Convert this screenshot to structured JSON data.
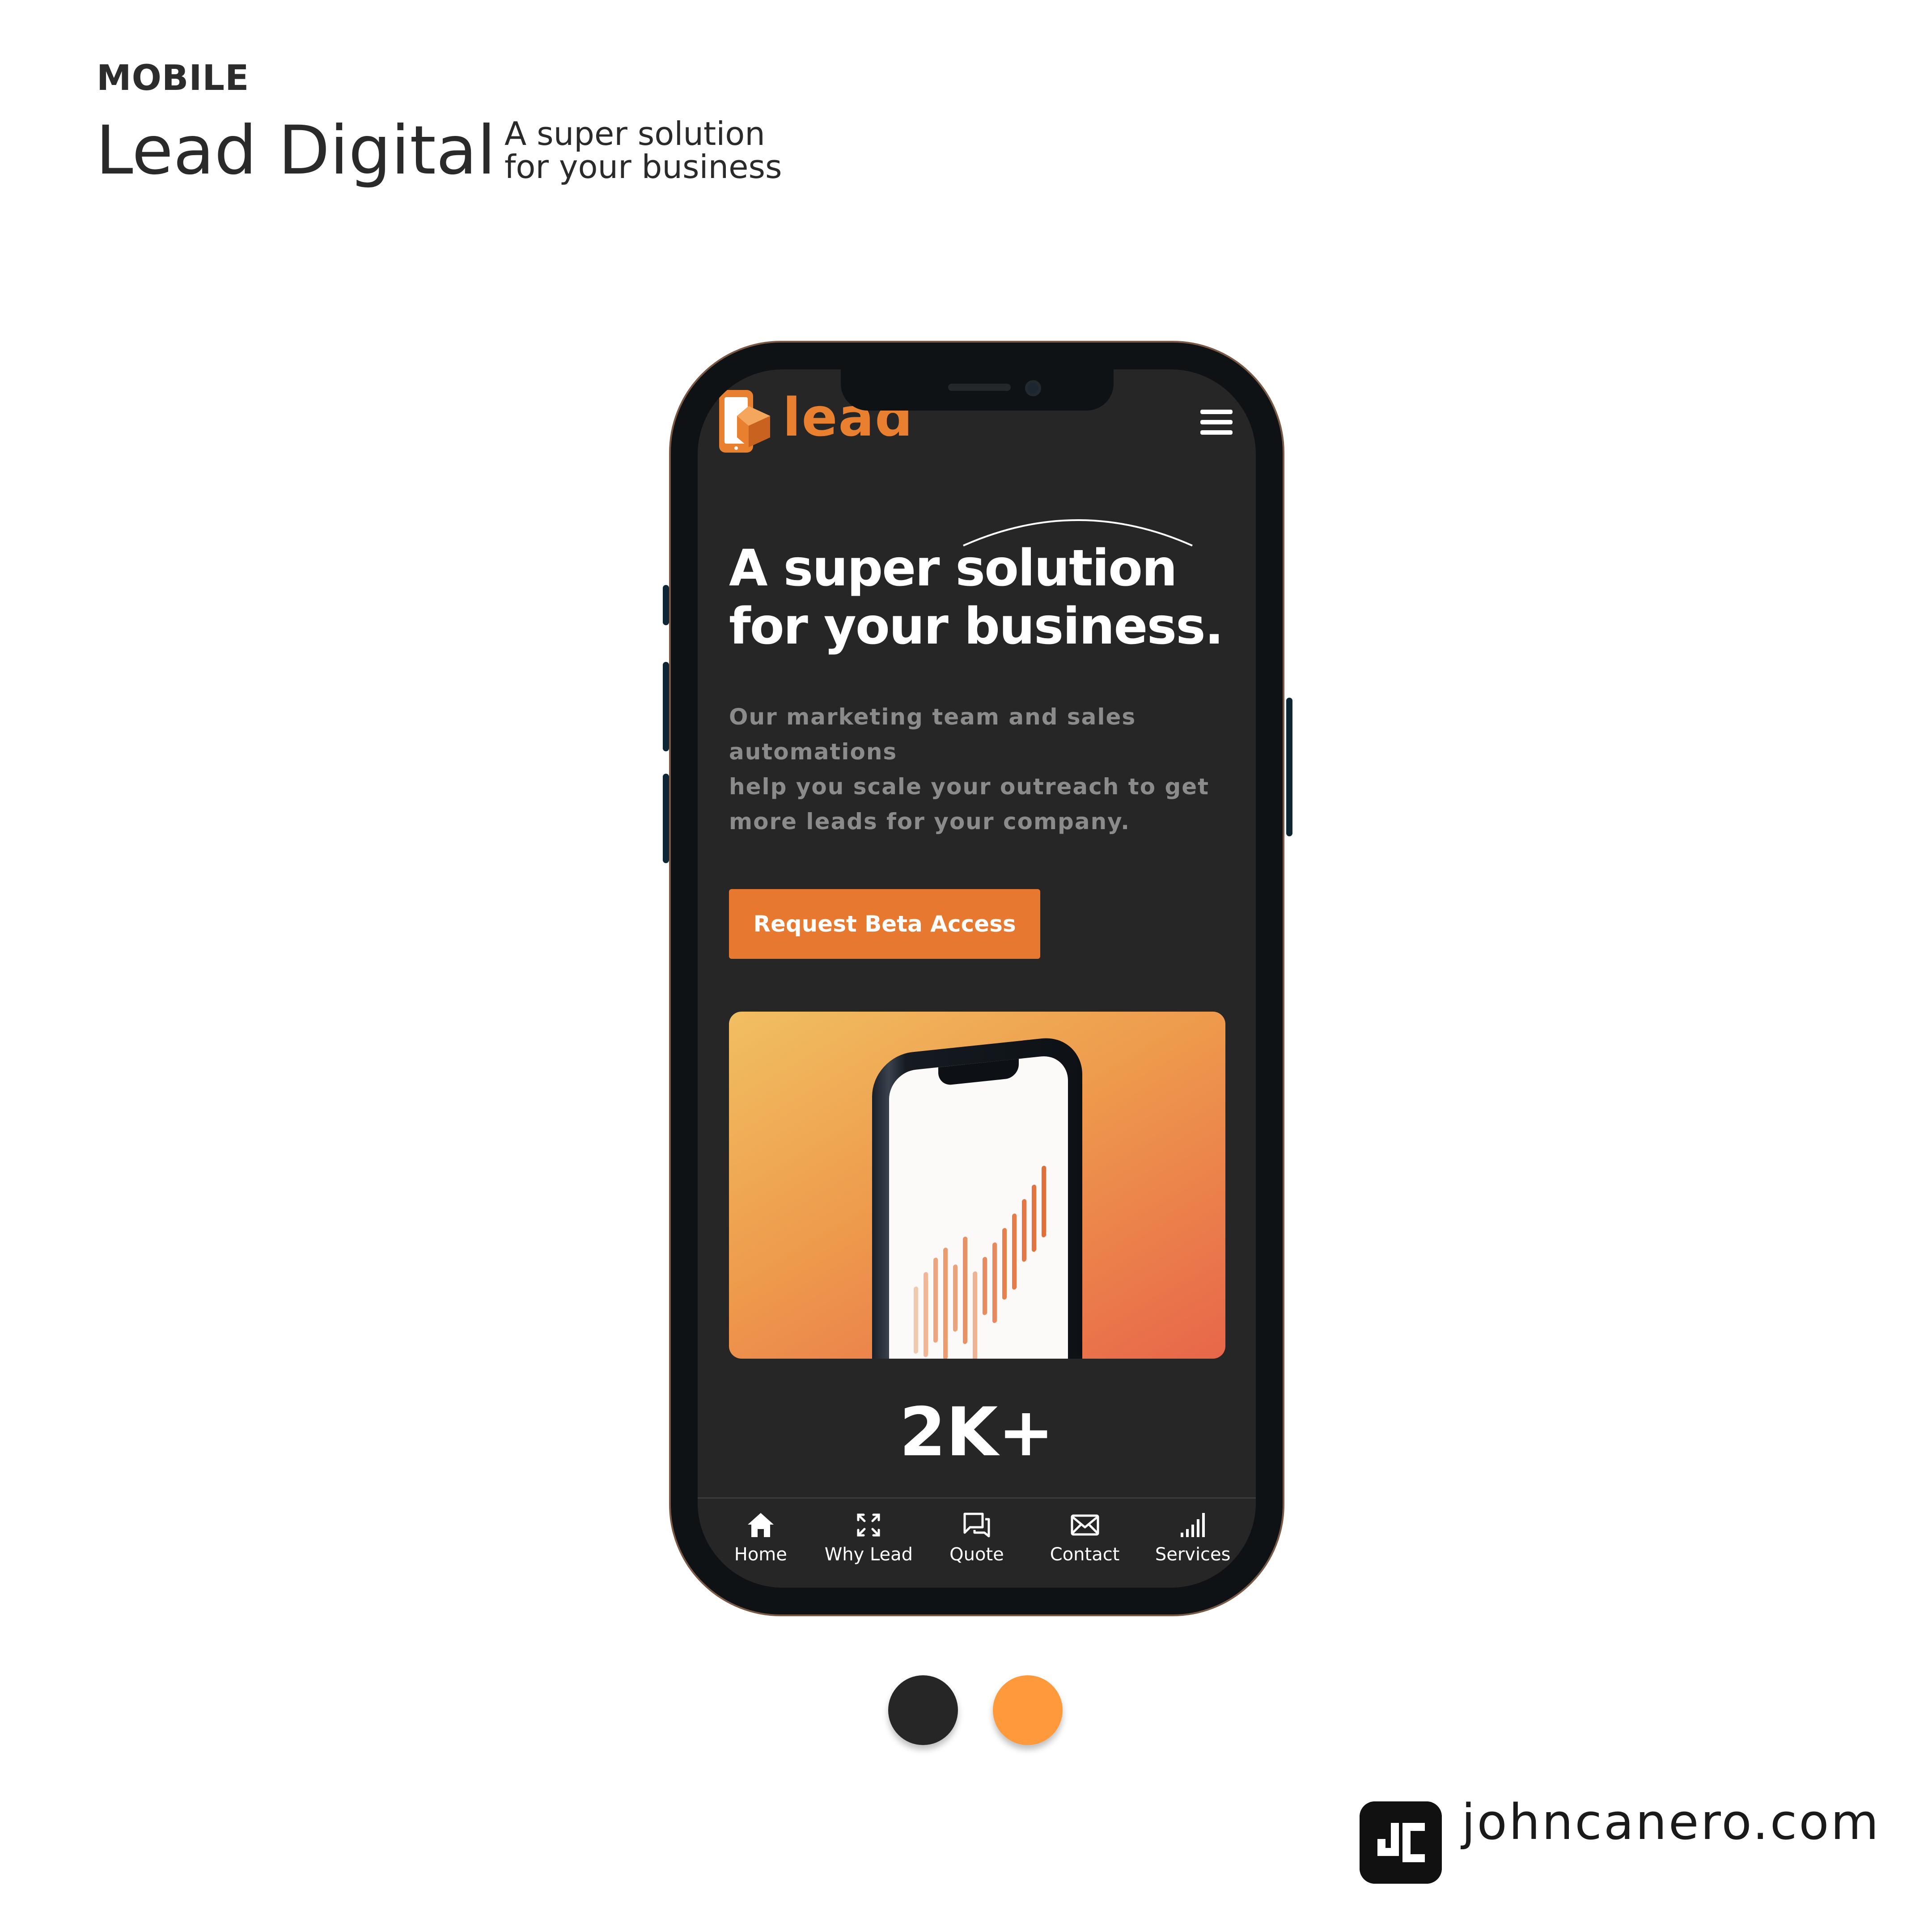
{
  "presentation": {
    "eyebrow": "MOBILE",
    "title": "Lead Digital",
    "subtitle_line1": "A super solution",
    "subtitle_line2": "for your business"
  },
  "app": {
    "logo_text": "lead",
    "menu_icon": "hamburger-icon",
    "hero": {
      "title_line1": "A super solution",
      "title_line2": "for your business.",
      "desc_line1": "Our marketing team and sales",
      "desc_line2": "automations",
      "desc_line3": "help you scale your outreach to get",
      "desc_line4": "more leads for your company.",
      "cta_label": "Request Beta Access"
    },
    "stat_value": "2K+",
    "nav": [
      {
        "label": "Home",
        "icon": "home-icon"
      },
      {
        "label": "Why Lead",
        "icon": "expand-icon"
      },
      {
        "label": "Quote",
        "icon": "chat-icon"
      },
      {
        "label": "Contact",
        "icon": "mail-icon"
      },
      {
        "label": "Services",
        "icon": "signal-bars-icon"
      }
    ]
  },
  "palette": {
    "dark": "#262626",
    "orange": "#FF9A3C"
  },
  "brand": {
    "url": "johncanero.com",
    "logo_icon": "jc-monogram-icon"
  }
}
